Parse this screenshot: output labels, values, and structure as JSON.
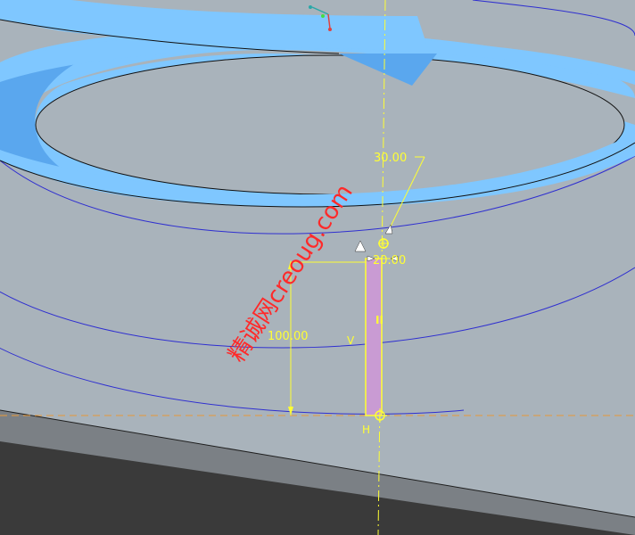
{
  "dimensions": {
    "top_value": "30.00",
    "width_value": "20.00",
    "height_value": "100.00"
  },
  "constraints": {
    "vertical": "V",
    "horizontal": "H",
    "parallel": "II"
  },
  "watermark": "精诚网creoug.com",
  "colors": {
    "background": "#a9b3bb",
    "sweep_light": "#7fc7ff",
    "sweep_dark": "#5aa7ee",
    "sketch_yellow": "#ffff33",
    "section_fill": "#c99bd3",
    "curve_blue": "#2f2fd0",
    "ground": "#3a3a3a",
    "watermark_red": "#ff2a2a"
  }
}
